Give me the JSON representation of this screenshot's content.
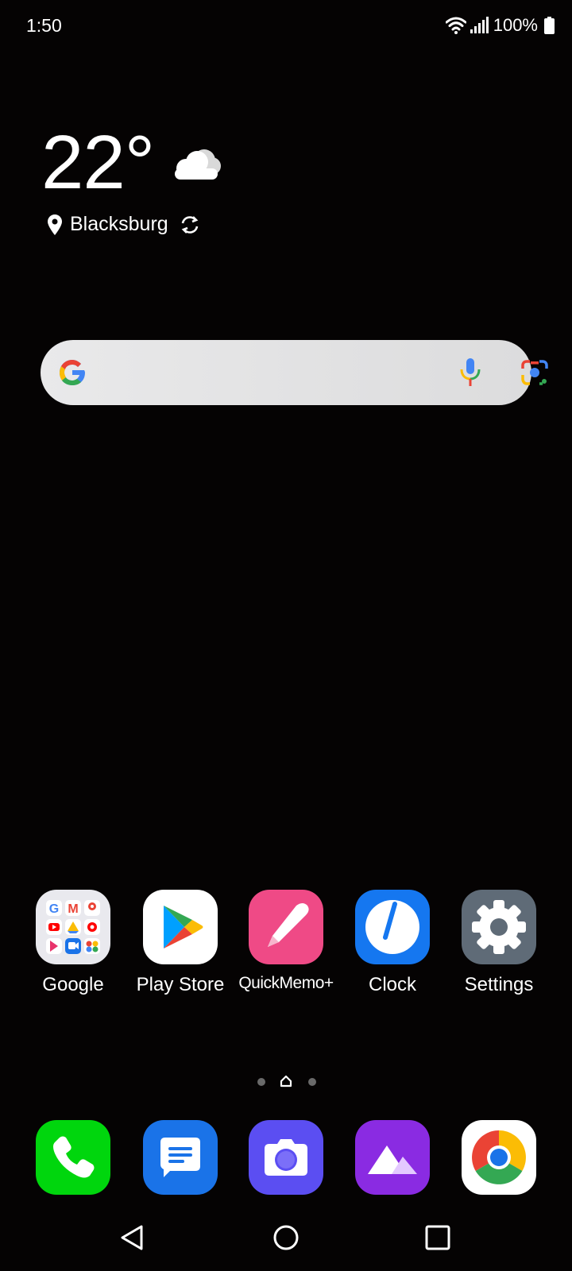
{
  "status": {
    "time": "1:50",
    "battery": "100%"
  },
  "weather": {
    "temperature": "22°",
    "condition_icon": "cloud-icon",
    "location": "Blacksburg"
  },
  "search": {
    "icons": [
      "google-g-icon",
      "microphone-icon",
      "google-lens-icon"
    ]
  },
  "apps": [
    {
      "label": "Google",
      "icon": "google-folder-icon"
    },
    {
      "label": "Play Store",
      "icon": "play-store-icon"
    },
    {
      "label": "QuickMemo+",
      "icon": "quickmemo-icon"
    },
    {
      "label": "Clock",
      "icon": "clock-icon"
    },
    {
      "label": "Settings",
      "icon": "settings-gear-icon"
    }
  ],
  "page_indicator": {
    "pages": 3,
    "current": "home"
  },
  "dock": [
    {
      "icon": "phone-icon"
    },
    {
      "icon": "messages-icon"
    },
    {
      "icon": "camera-icon"
    },
    {
      "icon": "gallery-icon"
    },
    {
      "icon": "chrome-icon"
    }
  ],
  "navbar": {
    "buttons": [
      "back-icon",
      "home-icon",
      "recents-icon"
    ]
  },
  "colors": {
    "background": "#050303",
    "search_bar": "#e3e3e4"
  }
}
